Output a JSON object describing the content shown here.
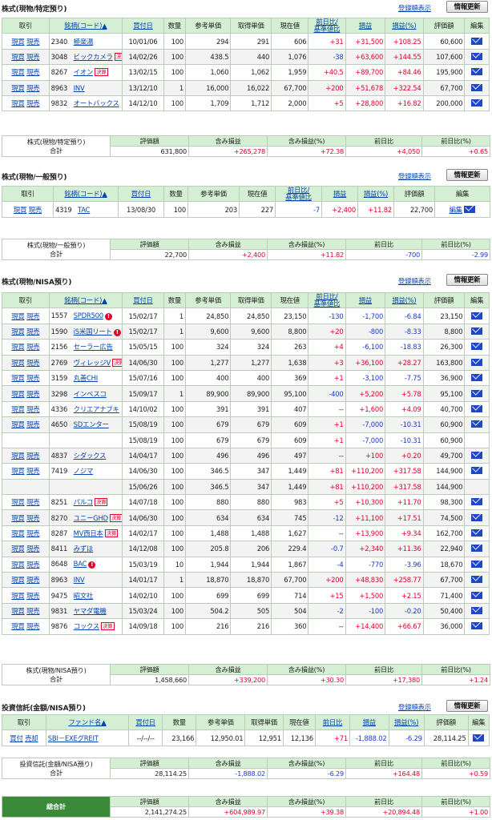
{
  "ui": {
    "sort_link": "登録順表示",
    "refresh_button": "情報更新",
    "buy_label": "現買",
    "sell_label": "現売",
    "edit_label": "編集",
    "mail_icon": "mail-icon",
    "settlement_tag": "決算",
    "warn_glyph": "!",
    "colors": {
      "header_bg": "#d5efd5",
      "plus": "#e4002b",
      "minus": "#1b39d1",
      "total_bg": "#3a8a3a"
    }
  },
  "sections": {
    "specific": {
      "title": "株式(現物/特定預り)",
      "headers": [
        "取引",
        "銘柄(コード)▲",
        "買付日",
        "数量",
        "参考単価",
        "取得単価",
        "現在値",
        "前日比/基準値比",
        "損益",
        "損益(%)",
        "評価額",
        "編集"
      ],
      "rows": [
        {
          "code": "2340",
          "name": "極楽湯",
          "date": "10/01/06",
          "qty": "100",
          "ref": "294",
          "acq": "291",
          "cur": "606",
          "diff": "+31",
          "pl": "+31,500",
          "plp": "+108.25",
          "val": "60,600"
        },
        {
          "code": "3048",
          "name": "ビックカメラ",
          "date": "14/02/26",
          "qty": "100",
          "ref": "438.5",
          "acq": "440",
          "cur": "1,076",
          "diff": "-38",
          "pl": "+63,600",
          "plp": "+144.55",
          "val": "107,600",
          "tag": true
        },
        {
          "code": "8267",
          "name": "イオン",
          "date": "13/02/15",
          "qty": "100",
          "ref": "1,060",
          "acq": "1,062",
          "cur": "1,959",
          "diff": "+40.5",
          "pl": "+89,700",
          "plp": "+84.46",
          "val": "195,900",
          "tag": true
        },
        {
          "code": "8963",
          "name": "INV",
          "date": "13/12/10",
          "qty": "1",
          "ref": "16,000",
          "acq": "16,022",
          "cur": "67,700",
          "diff": "+200",
          "pl": "+51,678",
          "plp": "+322.54",
          "val": "67,700"
        },
        {
          "code": "9832",
          "name": "オートバックス",
          "date": "14/12/10",
          "qty": "100",
          "ref": "1,709",
          "acq": "1,712",
          "cur": "2,000",
          "diff": "+5",
          "pl": "+28,800",
          "plp": "+16.82",
          "val": "200,000"
        }
      ],
      "summary": {
        "label1": "株式(現物/特定預り)",
        "label2": "合計",
        "h_val": "評価額",
        "h_pl": "含み損益",
        "h_plp": "含み損益(%)",
        "h_day": "前日比",
        "h_dayp": "前日比(%)",
        "val": "631,800",
        "pl": "+265,278",
        "plp": "+72.38",
        "day": "+4,050",
        "dayp": "+0.65"
      }
    },
    "general": {
      "title": "株式(現物/一般預り)",
      "headers": [
        "取引",
        "銘柄(コード)▲",
        "買付日",
        "数量",
        "参考単価",
        "現在値",
        "前日比/基準値比",
        "損益",
        "損益(%)",
        "評価額",
        "編集"
      ],
      "rows": [
        {
          "code": "4319",
          "name": "TAC",
          "date": "13/08/30",
          "qty": "100",
          "ref": "203",
          "cur": "227",
          "diff": "-7",
          "pl": "+2,400",
          "plp": "+11.82",
          "val": "22,700"
        }
      ],
      "summary": {
        "label1": "株式(現物/一般預り)",
        "label2": "合計",
        "val": "22,700",
        "pl": "+2,400",
        "plp": "+11.82",
        "day": "-700",
        "dayp": "-2.99"
      }
    },
    "nisa": {
      "title": "株式(現物/NISA預り)",
      "rows": [
        {
          "code": "1557",
          "name": "SPDR500",
          "date": "15/02/17",
          "qty": "1",
          "ref": "24,850",
          "acq": "24,850",
          "cur": "23,150",
          "diff": "-130",
          "pl": "-1,700",
          "plp": "-6.84",
          "val": "23,150",
          "warn": true
        },
        {
          "code": "1590",
          "name": "iS米国リート",
          "date": "15/02/17",
          "qty": "1",
          "ref": "9,600",
          "acq": "9,600",
          "cur": "8,800",
          "diff": "+20",
          "pl": "-800",
          "plp": "-8.33",
          "val": "8,800",
          "warn": true
        },
        {
          "code": "2156",
          "name": "セーラー広告",
          "date": "15/05/15",
          "qty": "100",
          "ref": "324",
          "acq": "324",
          "cur": "263",
          "diff": "+4",
          "pl": "-6,100",
          "plp": "-18.83",
          "val": "26,300"
        },
        {
          "code": "2769",
          "name": "ヴィレッジV",
          "date": "14/06/30",
          "qty": "100",
          "ref": "1,277",
          "acq": "1,277",
          "cur": "1,638",
          "diff": "+3",
          "pl": "+36,100",
          "plp": "+28.27",
          "val": "163,800",
          "tag": true
        },
        {
          "code": "3159",
          "name": "丸善CHI",
          "date": "15/07/16",
          "qty": "100",
          "ref": "400",
          "acq": "400",
          "cur": "369",
          "diff": "+1",
          "pl": "-3,100",
          "plp": "-7.75",
          "val": "36,900"
        },
        {
          "code": "3298",
          "name": "インベスコ",
          "date": "15/09/17",
          "qty": "1",
          "ref": "89,900",
          "acq": "89,900",
          "cur": "95,100",
          "diff": "-400",
          "pl": "+5,200",
          "plp": "+5.78",
          "val": "95,100"
        },
        {
          "code": "4336",
          "name": "クリエアナブキ",
          "date": "14/10/02",
          "qty": "100",
          "ref": "391",
          "acq": "391",
          "cur": "407",
          "diff": "--",
          "pl": "+1,600",
          "plp": "+4.09",
          "val": "40,700"
        },
        {
          "code": "4650",
          "name": "SDエンター",
          "date": "15/08/19",
          "qty": "100",
          "ref": "679",
          "acq": "679",
          "cur": "609",
          "diff": "+1",
          "pl": "-7,000",
          "plp": "-10.31",
          "val": "60,900"
        },
        {
          "cont": true,
          "date": "15/08/19",
          "qty": "100",
          "ref": "679",
          "acq": "679",
          "cur": "609",
          "diff": "+1",
          "pl": "-7,000",
          "plp": "-10.31",
          "val": "60,900"
        },
        {
          "code": "4837",
          "name": "シダックス",
          "date": "14/04/17",
          "qty": "100",
          "ref": "496",
          "acq": "496",
          "cur": "497",
          "diff": "--",
          "pl": "+100",
          "plp": "+0.20",
          "val": "49,700"
        },
        {
          "code": "7419",
          "name": "ノジマ",
          "date": "14/06/30",
          "qty": "100",
          "ref": "346.5",
          "acq": "347",
          "cur": "1,449",
          "diff": "+81",
          "pl": "+110,200",
          "plp": "+317.58",
          "val": "144,900"
        },
        {
          "cont": true,
          "date": "15/06/26",
          "qty": "100",
          "ref": "346.5",
          "acq": "347",
          "cur": "1,449",
          "diff": "+81",
          "pl": "+110,200",
          "plp": "+317.58",
          "val": "144,900"
        },
        {
          "code": "8251",
          "name": "パルコ",
          "date": "14/07/18",
          "qty": "100",
          "ref": "880",
          "acq": "880",
          "cur": "983",
          "diff": "+5",
          "pl": "+10,300",
          "plp": "+11.70",
          "val": "98,300",
          "tag": true
        },
        {
          "code": "8270",
          "name": "ユニーGHD",
          "date": "14/06/30",
          "qty": "100",
          "ref": "634",
          "acq": "634",
          "cur": "745",
          "diff": "-12",
          "pl": "+11,100",
          "plp": "+17.51",
          "val": "74,500",
          "tag": true
        },
        {
          "code": "8287",
          "name": "MV西日本",
          "date": "14/02/17",
          "qty": "100",
          "ref": "1,488",
          "acq": "1,488",
          "cur": "1,627",
          "diff": "--",
          "pl": "+13,900",
          "plp": "+9.34",
          "val": "162,700",
          "tag": true
        },
        {
          "code": "8411",
          "name": "みずほ",
          "date": "14/12/08",
          "qty": "100",
          "ref": "205.8",
          "acq": "206",
          "cur": "229.4",
          "diff": "-0.7",
          "pl": "+2,340",
          "plp": "+11.36",
          "val": "22,940"
        },
        {
          "code": "8648",
          "name": "BAC",
          "date": "15/03/19",
          "qty": "10",
          "ref": "1,944",
          "acq": "1,944",
          "cur": "1,867",
          "diff": "-4",
          "pl": "-770",
          "plp": "-3.96",
          "val": "18,670",
          "warn": true
        },
        {
          "code": "8963",
          "name": "INV",
          "date": "14/01/17",
          "qty": "1",
          "ref": "18,870",
          "acq": "18,870",
          "cur": "67,700",
          "diff": "+200",
          "pl": "+48,830",
          "plp": "+258.77",
          "val": "67,700"
        },
        {
          "code": "9475",
          "name": "昭文社",
          "date": "14/02/10",
          "qty": "100",
          "ref": "699",
          "acq": "699",
          "cur": "714",
          "diff": "+15",
          "pl": "+1,500",
          "plp": "+2.15",
          "val": "71,400"
        },
        {
          "code": "9831",
          "name": "ヤマダ電機",
          "date": "15/03/24",
          "qty": "100",
          "ref": "504.2",
          "acq": "505",
          "cur": "504",
          "diff": "-2",
          "pl": "-100",
          "plp": "-0.20",
          "val": "50,400"
        },
        {
          "code": "9876",
          "name": "コックス",
          "date": "14/09/18",
          "qty": "100",
          "ref": "216",
          "acq": "216",
          "cur": "360",
          "diff": "--",
          "pl": "+14,400",
          "plp": "+66.67",
          "val": "36,000",
          "tag": true
        }
      ],
      "summary": {
        "label1": "株式(現物/NISA預り)",
        "label2": "合計",
        "val": "1,458,660",
        "pl": "+339,200",
        "plp": "+30.30",
        "day": "+17,380",
        "dayp": "+1.24"
      }
    },
    "fund": {
      "title": "投資信託(金額/NISA預り)",
      "headers": [
        "取引",
        "ファンド名▲",
        "買付日",
        "数量",
        "参考単価",
        "取得単価",
        "現在値",
        "前日比",
        "損益",
        "損益(%)",
        "評価額",
        "編集"
      ],
      "rows": [
        {
          "buy": "買付",
          "sell": "売却",
          "name": "SBI－EXEグREIT",
          "date": "--/--/--",
          "qty": "23,166",
          "ref": "12,950.01",
          "acq": "12,951",
          "cur": "12,136",
          "diff": "+71",
          "pl": "-1,888.02",
          "plp": "-6.29",
          "val": "28,114.25"
        }
      ],
      "summary": {
        "label1": "投資信託(金額/NISA預り)",
        "label2": "合計",
        "val": "28,114.25",
        "pl": "-1,888.02",
        "plp": "-6.29",
        "day": "+164.48",
        "dayp": "+0.59"
      }
    },
    "total": {
      "label": "総合計",
      "val": "2,141,274.25",
      "pl": "+604,989.97",
      "plp": "+39.38",
      "day": "+20,894.48",
      "dayp": "+1.00"
    }
  }
}
